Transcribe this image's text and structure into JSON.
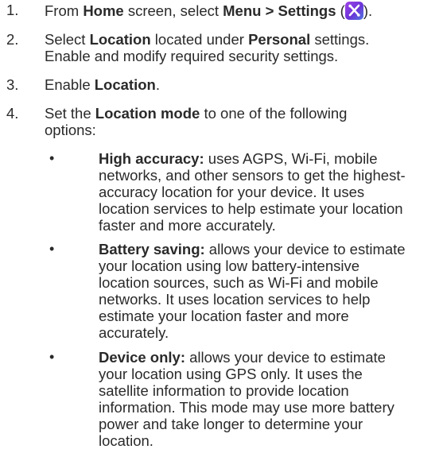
{
  "steps": [
    {
      "number": "1.",
      "parts": {
        "t1": "From ",
        "b1": "Home",
        "t2": " screen, select ",
        "b2": "Menu > Settings",
        "t3": " (",
        "t4": ")."
      },
      "icon": "settings-icon"
    },
    {
      "number": "2.",
      "parts": {
        "t1": "Select ",
        "b1": "Location",
        "t2": " located under ",
        "b2": "Personal",
        "t3": " settings.",
        "line2": "Enable and modify required security settings."
      }
    },
    {
      "number": "3.",
      "parts": {
        "t1": "Enable ",
        "b1": "Location",
        "t2": "."
      }
    },
    {
      "number": "4.",
      "parts": {
        "t1": "Set the ",
        "b1": "Location mode",
        "t2": " to one of the following",
        "line2": "options:"
      }
    }
  ],
  "options": [
    {
      "bullet": "•",
      "title": "High accuracy:",
      "lines": [
        " uses AGPS, Wi-Fi, mobile",
        "networks, and other sensors to get the highest-",
        "accuracy location for your device. It uses",
        "location services to help estimate your location",
        "faster and more accurately."
      ]
    },
    {
      "bullet": "•",
      "title": "Battery saving:",
      "lines": [
        " allows your device to estimate",
        "your location using low battery-intensive",
        "location sources, such as Wi-Fi and mobile",
        "networks. It uses location services to help",
        "estimate your location faster and more",
        "accurately."
      ]
    },
    {
      "bullet": "•",
      "title": "Device only:",
      "lines": [
        " allows your device to estimate",
        "your location using GPS only. It uses the",
        "satellite information to provide location",
        "information. This mode may use more battery",
        "power and take longer to determine your",
        "location."
      ]
    }
  ]
}
